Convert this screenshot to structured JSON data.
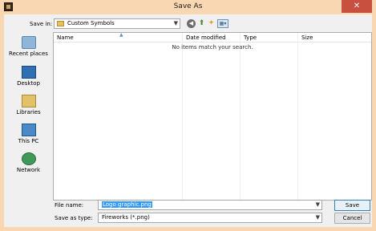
{
  "window": {
    "title": "Save As",
    "close_glyph": "✕"
  },
  "toolbar": {
    "save_in_label": "Save in:",
    "save_in_value": "Custom Symbols",
    "icons": [
      "back-icon",
      "up-folder-icon",
      "new-folder-icon",
      "view-menu-icon"
    ]
  },
  "places": [
    {
      "label": "Recent places",
      "icon": "recent-places-icon"
    },
    {
      "label": "Desktop",
      "icon": "desktop-icon"
    },
    {
      "label": "Libraries",
      "icon": "libraries-icon"
    },
    {
      "label": "This PC",
      "icon": "this-pc-icon"
    },
    {
      "label": "Network",
      "icon": "network-icon"
    }
  ],
  "file_list": {
    "columns": [
      "Name",
      "Date modified",
      "Type",
      "Size"
    ],
    "empty_message": "No items match your search."
  },
  "footer": {
    "file_name_label": "File name:",
    "file_name_value": "Logo graphic.png",
    "save_as_type_label": "Save as type:",
    "save_as_type_value": "Fireworks (*.png)",
    "save_button": "Save",
    "cancel_button": "Cancel"
  }
}
